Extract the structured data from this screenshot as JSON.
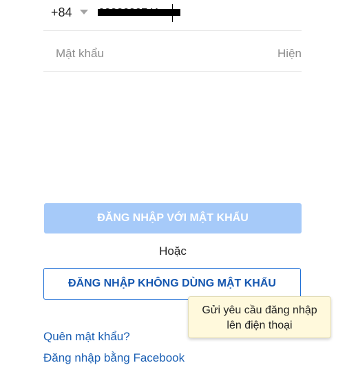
{
  "phone": {
    "country_code": "+84",
    "number_value": "0333230741"
  },
  "password": {
    "placeholder": "Mật khẩu",
    "show_label": "Hiện"
  },
  "buttons": {
    "login_with_password": "ĐĂNG NHẬP VỚI MẬT KHẨU",
    "or_label": "Hoặc",
    "login_without_password": "ĐĂNG NHẬP KHÔNG DÙNG MẬT KHẨU"
  },
  "tooltip": {
    "line1": "Gửi yêu cầu đăng nhập",
    "line2": "lên điện thoại"
  },
  "links": {
    "forgot_password": "Quên mật khẩu?",
    "facebook_login": "Đăng nhập bằng Facebook"
  },
  "colors": {
    "primary_disabled": "#a6caf9",
    "link": "#1a5fb4",
    "outline_button": "#1f6fd6",
    "tooltip_bg": "#fff9dc"
  },
  "icons": {
    "country_dropdown": "chevron-down-icon"
  }
}
